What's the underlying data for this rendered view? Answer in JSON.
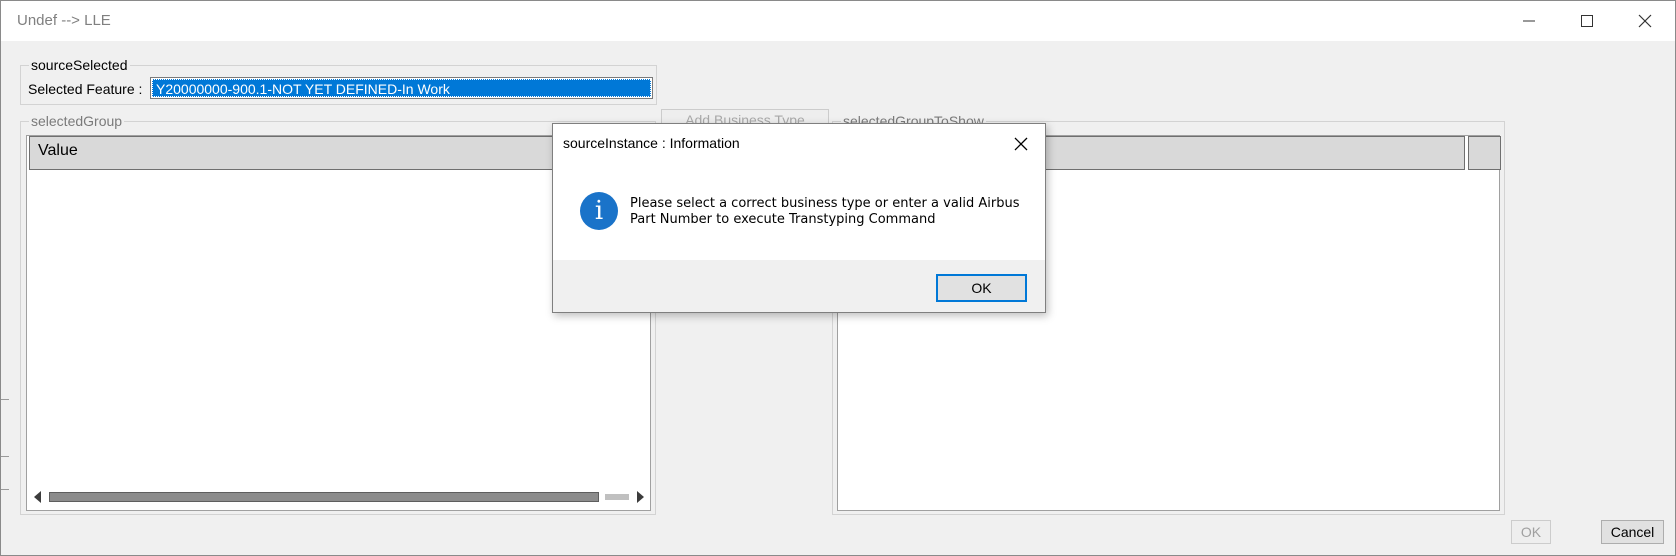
{
  "window": {
    "title": "Undef --> LLE",
    "minimize_icon": "minimize-icon",
    "maximize_icon": "maximize-icon",
    "close_icon": "close-icon"
  },
  "source_selected": {
    "legend": "sourceSelected",
    "feature_label": "Selected Feature :",
    "feature_value": "Y20000000-900.1-NOT YET DEFINED-In Work"
  },
  "selected_group": {
    "legend": "selectedGroup",
    "column_header": "Value"
  },
  "add_business_type_button": "Add Business Type",
  "selected_group_to_show": {
    "legend": "selectedGroupToShow"
  },
  "footer": {
    "ok_label": "OK",
    "cancel_label": "Cancel"
  },
  "dialog": {
    "title": "sourceInstance : Information",
    "icon": "info-icon",
    "message_line1": "Please select a correct business type or enter a valid Airbus",
    "message_line2": "Part Number to execute Transtyping Command",
    "ok_label": "OK"
  },
  "colors": {
    "selection": "#0078d7",
    "info_icon": "#1a73c9",
    "window_bg": "#f0f0f0"
  }
}
